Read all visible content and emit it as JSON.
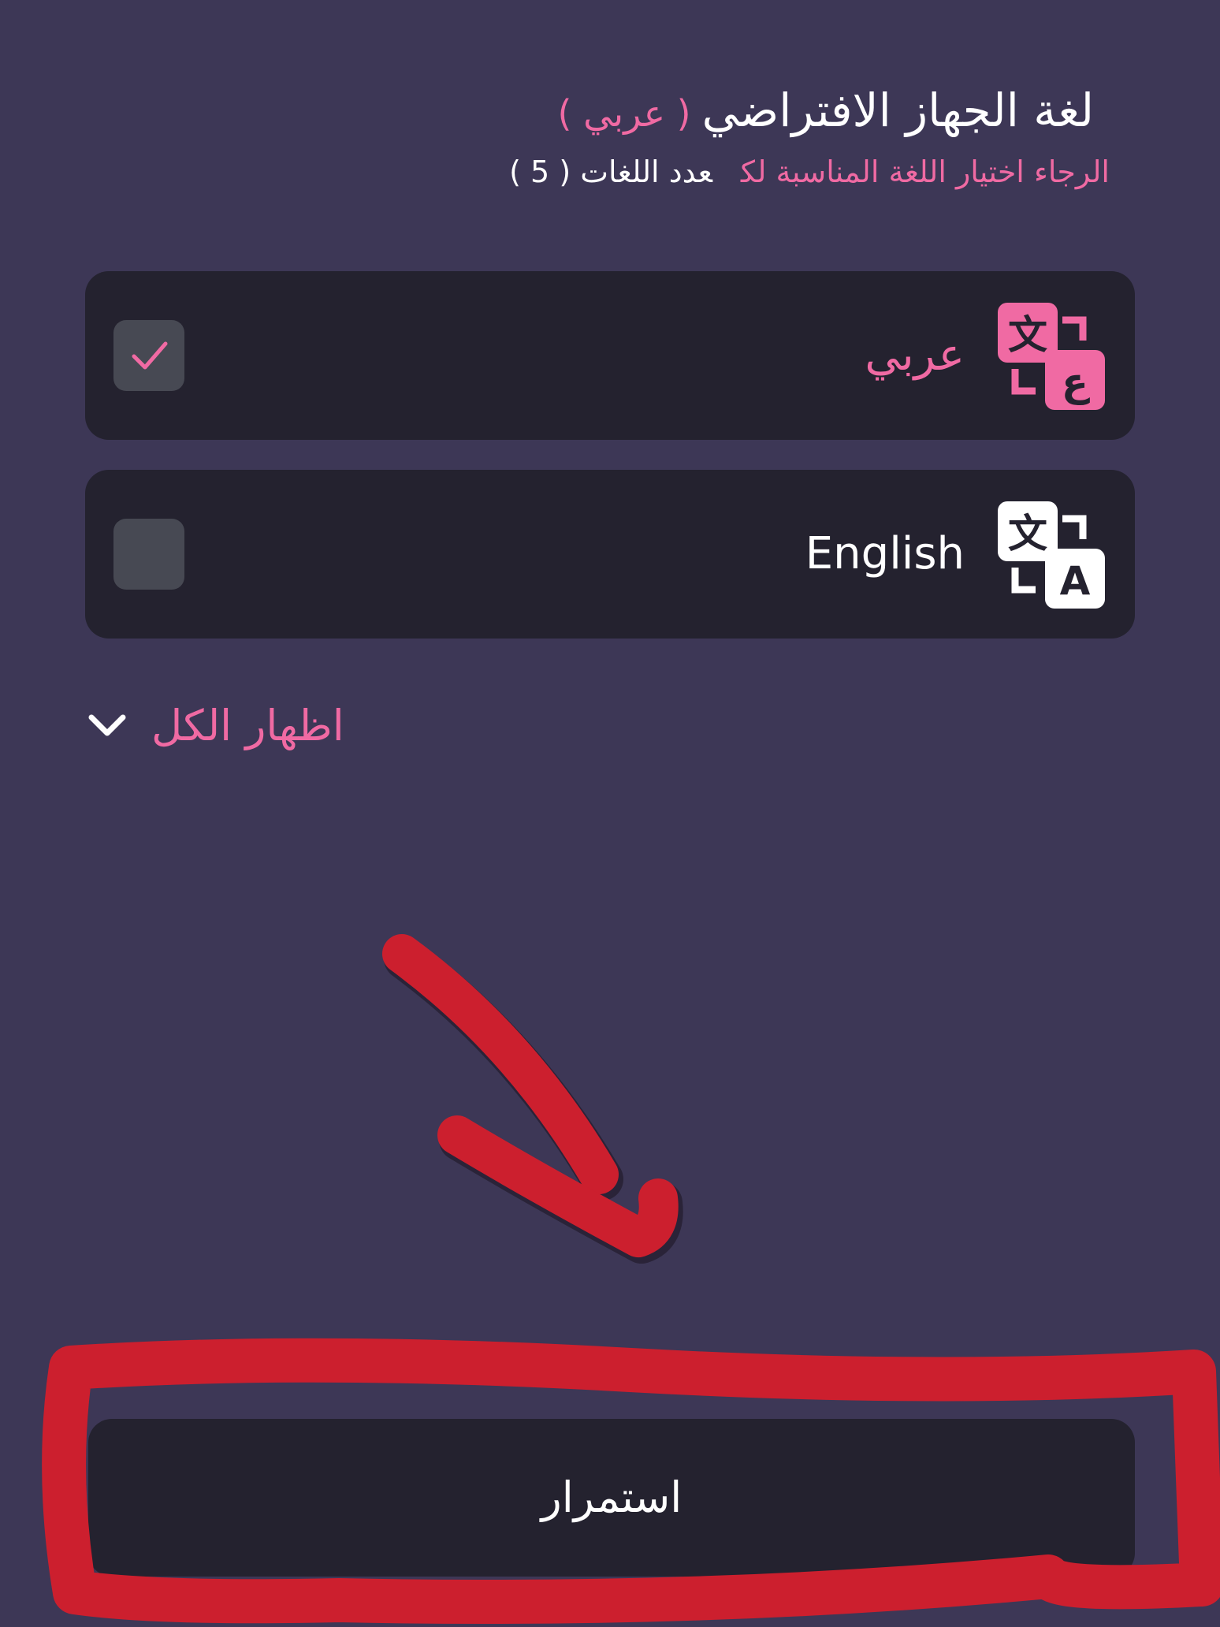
{
  "header": {
    "title": "لغة الجهاز الافتراضي",
    "current_language": "( عربي )",
    "hint": "الرجاء اختيار اللغة المناسبة لك",
    "count": "عدد اللغات ( 5 )"
  },
  "languages": [
    {
      "label": "عربي",
      "icon_letter": "ع",
      "icon_name": "translate-arabic-icon",
      "checked": true
    },
    {
      "label": "English",
      "icon_letter": "A",
      "icon_name": "translate-english-icon",
      "checked": false
    }
  ],
  "show_all": {
    "label": "اظهار الكل",
    "icon": "chevron-down-icon"
  },
  "continue_button": {
    "label": "استمرار"
  },
  "colors": {
    "background": "#3d3756",
    "card": "#24222f",
    "accent": "#f06aa3",
    "checkbox": "#474953",
    "annotation": "#cc1f2e"
  }
}
